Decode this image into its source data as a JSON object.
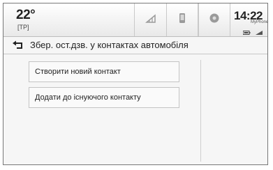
{
  "status": {
    "temperature": "22°",
    "traffic_program": "[TP]",
    "time": "14:22",
    "phone_name": "MyPhone"
  },
  "tabs": [
    {
      "icon": "audio-icon"
    },
    {
      "icon": "phone-icon"
    },
    {
      "icon": "navigation-icon"
    }
  ],
  "header": {
    "back_icon": "back-arrow-icon",
    "title": "Збер. ост.дзв. у контактах автомобіля"
  },
  "options": [
    {
      "label": "Створити новий контакт"
    },
    {
      "label": "Додати до існуючого контакту"
    }
  ],
  "colors": {
    "background": "#f6f6f6",
    "text": "#222222",
    "icons": "#9a9a9a"
  }
}
